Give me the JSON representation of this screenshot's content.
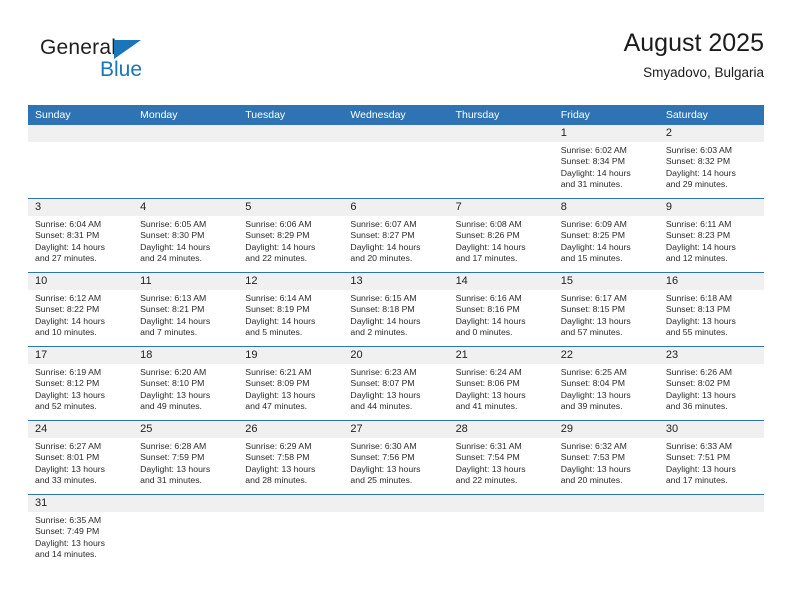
{
  "brand": {
    "name_part1": "General",
    "name_part2": "Blue"
  },
  "header": {
    "title": "August 2025",
    "subtitle": "Smyadovo, Bulgaria"
  },
  "colors": {
    "header_blue": "#2e74b5",
    "brand_blue": "#1a75bb",
    "day_number_bg": "#f0f0f0",
    "text": "#2b2b2b"
  },
  "weekdays": [
    {
      "label": "Sunday"
    },
    {
      "label": "Monday"
    },
    {
      "label": "Tuesday"
    },
    {
      "label": "Wednesday"
    },
    {
      "label": "Thursday"
    },
    {
      "label": "Friday"
    },
    {
      "label": "Saturday"
    }
  ],
  "weeks": [
    [
      {
        "day": "",
        "sunrise": "",
        "sunset": "",
        "daylight_line1": "",
        "daylight_line2": "",
        "empty": true
      },
      {
        "day": "",
        "sunrise": "",
        "sunset": "",
        "daylight_line1": "",
        "daylight_line2": "",
        "empty": true
      },
      {
        "day": "",
        "sunrise": "",
        "sunset": "",
        "daylight_line1": "",
        "daylight_line2": "",
        "empty": true
      },
      {
        "day": "",
        "sunrise": "",
        "sunset": "",
        "daylight_line1": "",
        "daylight_line2": "",
        "empty": true
      },
      {
        "day": "",
        "sunrise": "",
        "sunset": "",
        "daylight_line1": "",
        "daylight_line2": "",
        "empty": true
      },
      {
        "day": "1",
        "sunrise": "Sunrise: 6:02 AM",
        "sunset": "Sunset: 8:34 PM",
        "daylight_line1": "Daylight: 14 hours",
        "daylight_line2": "and 31 minutes.",
        "empty": false
      },
      {
        "day": "2",
        "sunrise": "Sunrise: 6:03 AM",
        "sunset": "Sunset: 8:32 PM",
        "daylight_line1": "Daylight: 14 hours",
        "daylight_line2": "and 29 minutes.",
        "empty": false
      }
    ],
    [
      {
        "day": "3",
        "sunrise": "Sunrise: 6:04 AM",
        "sunset": "Sunset: 8:31 PM",
        "daylight_line1": "Daylight: 14 hours",
        "daylight_line2": "and 27 minutes.",
        "empty": false
      },
      {
        "day": "4",
        "sunrise": "Sunrise: 6:05 AM",
        "sunset": "Sunset: 8:30 PM",
        "daylight_line1": "Daylight: 14 hours",
        "daylight_line2": "and 24 minutes.",
        "empty": false
      },
      {
        "day": "5",
        "sunrise": "Sunrise: 6:06 AM",
        "sunset": "Sunset: 8:29 PM",
        "daylight_line1": "Daylight: 14 hours",
        "daylight_line2": "and 22 minutes.",
        "empty": false
      },
      {
        "day": "6",
        "sunrise": "Sunrise: 6:07 AM",
        "sunset": "Sunset: 8:27 PM",
        "daylight_line1": "Daylight: 14 hours",
        "daylight_line2": "and 20 minutes.",
        "empty": false
      },
      {
        "day": "7",
        "sunrise": "Sunrise: 6:08 AM",
        "sunset": "Sunset: 8:26 PM",
        "daylight_line1": "Daylight: 14 hours",
        "daylight_line2": "and 17 minutes.",
        "empty": false
      },
      {
        "day": "8",
        "sunrise": "Sunrise: 6:09 AM",
        "sunset": "Sunset: 8:25 PM",
        "daylight_line1": "Daylight: 14 hours",
        "daylight_line2": "and 15 minutes.",
        "empty": false
      },
      {
        "day": "9",
        "sunrise": "Sunrise: 6:11 AM",
        "sunset": "Sunset: 8:23 PM",
        "daylight_line1": "Daylight: 14 hours",
        "daylight_line2": "and 12 minutes.",
        "empty": false
      }
    ],
    [
      {
        "day": "10",
        "sunrise": "Sunrise: 6:12 AM",
        "sunset": "Sunset: 8:22 PM",
        "daylight_line1": "Daylight: 14 hours",
        "daylight_line2": "and 10 minutes.",
        "empty": false
      },
      {
        "day": "11",
        "sunrise": "Sunrise: 6:13 AM",
        "sunset": "Sunset: 8:21 PM",
        "daylight_line1": "Daylight: 14 hours",
        "daylight_line2": "and 7 minutes.",
        "empty": false
      },
      {
        "day": "12",
        "sunrise": "Sunrise: 6:14 AM",
        "sunset": "Sunset: 8:19 PM",
        "daylight_line1": "Daylight: 14 hours",
        "daylight_line2": "and 5 minutes.",
        "empty": false
      },
      {
        "day": "13",
        "sunrise": "Sunrise: 6:15 AM",
        "sunset": "Sunset: 8:18 PM",
        "daylight_line1": "Daylight: 14 hours",
        "daylight_line2": "and 2 minutes.",
        "empty": false
      },
      {
        "day": "14",
        "sunrise": "Sunrise: 6:16 AM",
        "sunset": "Sunset: 8:16 PM",
        "daylight_line1": "Daylight: 14 hours",
        "daylight_line2": "and 0 minutes.",
        "empty": false
      },
      {
        "day": "15",
        "sunrise": "Sunrise: 6:17 AM",
        "sunset": "Sunset: 8:15 PM",
        "daylight_line1": "Daylight: 13 hours",
        "daylight_line2": "and 57 minutes.",
        "empty": false
      },
      {
        "day": "16",
        "sunrise": "Sunrise: 6:18 AM",
        "sunset": "Sunset: 8:13 PM",
        "daylight_line1": "Daylight: 13 hours",
        "daylight_line2": "and 55 minutes.",
        "empty": false
      }
    ],
    [
      {
        "day": "17",
        "sunrise": "Sunrise: 6:19 AM",
        "sunset": "Sunset: 8:12 PM",
        "daylight_line1": "Daylight: 13 hours",
        "daylight_line2": "and 52 minutes.",
        "empty": false
      },
      {
        "day": "18",
        "sunrise": "Sunrise: 6:20 AM",
        "sunset": "Sunset: 8:10 PM",
        "daylight_line1": "Daylight: 13 hours",
        "daylight_line2": "and 49 minutes.",
        "empty": false
      },
      {
        "day": "19",
        "sunrise": "Sunrise: 6:21 AM",
        "sunset": "Sunset: 8:09 PM",
        "daylight_line1": "Daylight: 13 hours",
        "daylight_line2": "and 47 minutes.",
        "empty": false
      },
      {
        "day": "20",
        "sunrise": "Sunrise: 6:23 AM",
        "sunset": "Sunset: 8:07 PM",
        "daylight_line1": "Daylight: 13 hours",
        "daylight_line2": "and 44 minutes.",
        "empty": false
      },
      {
        "day": "21",
        "sunrise": "Sunrise: 6:24 AM",
        "sunset": "Sunset: 8:06 PM",
        "daylight_line1": "Daylight: 13 hours",
        "daylight_line2": "and 41 minutes.",
        "empty": false
      },
      {
        "day": "22",
        "sunrise": "Sunrise: 6:25 AM",
        "sunset": "Sunset: 8:04 PM",
        "daylight_line1": "Daylight: 13 hours",
        "daylight_line2": "and 39 minutes.",
        "empty": false
      },
      {
        "day": "23",
        "sunrise": "Sunrise: 6:26 AM",
        "sunset": "Sunset: 8:02 PM",
        "daylight_line1": "Daylight: 13 hours",
        "daylight_line2": "and 36 minutes.",
        "empty": false
      }
    ],
    [
      {
        "day": "24",
        "sunrise": "Sunrise: 6:27 AM",
        "sunset": "Sunset: 8:01 PM",
        "daylight_line1": "Daylight: 13 hours",
        "daylight_line2": "and 33 minutes.",
        "empty": false
      },
      {
        "day": "25",
        "sunrise": "Sunrise: 6:28 AM",
        "sunset": "Sunset: 7:59 PM",
        "daylight_line1": "Daylight: 13 hours",
        "daylight_line2": "and 31 minutes.",
        "empty": false
      },
      {
        "day": "26",
        "sunrise": "Sunrise: 6:29 AM",
        "sunset": "Sunset: 7:58 PM",
        "daylight_line1": "Daylight: 13 hours",
        "daylight_line2": "and 28 minutes.",
        "empty": false
      },
      {
        "day": "27",
        "sunrise": "Sunrise: 6:30 AM",
        "sunset": "Sunset: 7:56 PM",
        "daylight_line1": "Daylight: 13 hours",
        "daylight_line2": "and 25 minutes.",
        "empty": false
      },
      {
        "day": "28",
        "sunrise": "Sunrise: 6:31 AM",
        "sunset": "Sunset: 7:54 PM",
        "daylight_line1": "Daylight: 13 hours",
        "daylight_line2": "and 22 minutes.",
        "empty": false
      },
      {
        "day": "29",
        "sunrise": "Sunrise: 6:32 AM",
        "sunset": "Sunset: 7:53 PM",
        "daylight_line1": "Daylight: 13 hours",
        "daylight_line2": "and 20 minutes.",
        "empty": false
      },
      {
        "day": "30",
        "sunrise": "Sunrise: 6:33 AM",
        "sunset": "Sunset: 7:51 PM",
        "daylight_line1": "Daylight: 13 hours",
        "daylight_line2": "and 17 minutes.",
        "empty": false
      }
    ],
    [
      {
        "day": "31",
        "sunrise": "Sunrise: 6:35 AM",
        "sunset": "Sunset: 7:49 PM",
        "daylight_line1": "Daylight: 13 hours",
        "daylight_line2": "and 14 minutes.",
        "empty": false
      },
      {
        "day": "",
        "sunrise": "",
        "sunset": "",
        "daylight_line1": "",
        "daylight_line2": "",
        "empty": true
      },
      {
        "day": "",
        "sunrise": "",
        "sunset": "",
        "daylight_line1": "",
        "daylight_line2": "",
        "empty": true
      },
      {
        "day": "",
        "sunrise": "",
        "sunset": "",
        "daylight_line1": "",
        "daylight_line2": "",
        "empty": true
      },
      {
        "day": "",
        "sunrise": "",
        "sunset": "",
        "daylight_line1": "",
        "daylight_line2": "",
        "empty": true
      },
      {
        "day": "",
        "sunrise": "",
        "sunset": "",
        "daylight_line1": "",
        "daylight_line2": "",
        "empty": true
      },
      {
        "day": "",
        "sunrise": "",
        "sunset": "",
        "daylight_line1": "",
        "daylight_line2": "",
        "empty": true
      }
    ]
  ]
}
